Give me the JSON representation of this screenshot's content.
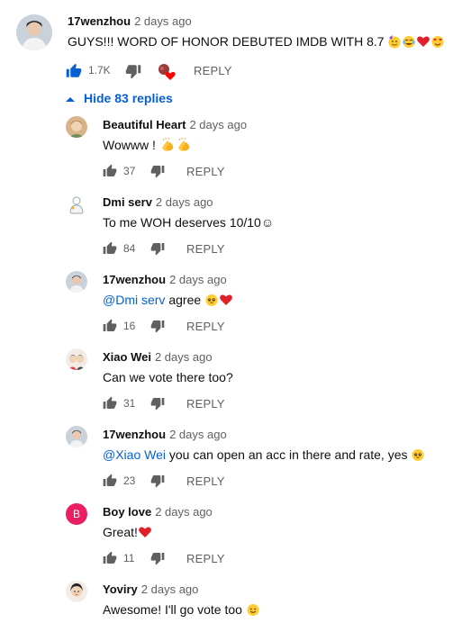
{
  "colors": {
    "link_blue": "#065fd4",
    "meta_gray": "#606060",
    "boy_love_avatar": "#e91e63"
  },
  "top_comment": {
    "author": "17wenzhou",
    "time": "2 days ago",
    "text": "GUYS!!! WORD OF HONOR DEBUTED IMDB WITH 8.7",
    "likes": "1.7K",
    "reply_label": "REPLY",
    "liked": true,
    "creator_heart": true
  },
  "replies_toggle": {
    "label": "Hide 83 replies",
    "icon": "chevron-up-icon"
  },
  "replies": [
    {
      "author": "Beautiful Heart",
      "time": "2 days ago",
      "mention": "",
      "text": "Wowww ! ",
      "likes": "37",
      "reply_label": "REPLY"
    },
    {
      "author": "Dmi serv",
      "time": "2 days ago",
      "mention": "",
      "text": "To me WOH deserves 10/10☺",
      "likes": "84",
      "reply_label": "REPLY"
    },
    {
      "author": "17wenzhou",
      "time": "2 days ago",
      "mention": "@Dmi serv",
      "text": "agree ",
      "likes": "16",
      "reply_label": "REPLY"
    },
    {
      "author": "Xiao Wei",
      "time": "2 days ago",
      "mention": "",
      "text": "Can we vote there too?",
      "likes": "31",
      "reply_label": "REPLY"
    },
    {
      "author": "17wenzhou",
      "time": "2 days ago",
      "mention": "@Xiao Wei",
      "text": "you can open an acc in there and rate, yes ",
      "likes": "23",
      "reply_label": "REPLY"
    },
    {
      "author": "Boy love",
      "time": "2 days ago",
      "mention": "",
      "text": "Great!",
      "likes": "11",
      "reply_label": "REPLY",
      "avatar_letter": "B"
    },
    {
      "author": "Yoviry",
      "time": "2 days ago",
      "mention": "",
      "text": "Awesome! I'll go vote too ",
      "likes": "",
      "reply_label": ""
    }
  ]
}
